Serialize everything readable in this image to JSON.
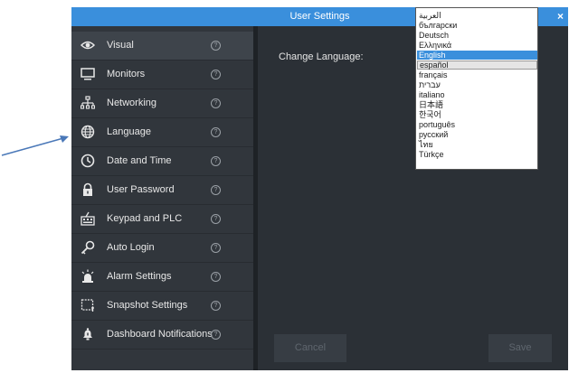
{
  "window": {
    "title": "User Settings",
    "close_glyph": "×"
  },
  "sidebar": {
    "items": [
      {
        "label": "Visual",
        "icon": "eye-icon"
      },
      {
        "label": "Monitors",
        "icon": "monitor-icon"
      },
      {
        "label": "Networking",
        "icon": "network-icon"
      },
      {
        "label": "Language",
        "icon": "globe-icon"
      },
      {
        "label": "Date and Time",
        "icon": "clock-icon"
      },
      {
        "label": "User Password",
        "icon": "lock-icon"
      },
      {
        "label": "Keypad and PLC",
        "icon": "keypad-icon"
      },
      {
        "label": "Auto Login",
        "icon": "key-icon"
      },
      {
        "label": "Alarm Settings",
        "icon": "alarm-icon"
      },
      {
        "label": "Snapshot Settings",
        "icon": "snapshot-icon"
      },
      {
        "label": "Dashboard Notifications",
        "icon": "bell-icon"
      }
    ],
    "help_glyph": "?"
  },
  "content": {
    "change_language_label": "Change Language:",
    "cancel_label": "Cancel",
    "save_label": "Save"
  },
  "language_dropdown": {
    "options": [
      "العربية",
      "български",
      "Deutsch",
      "Ελληνικά",
      "English",
      "español",
      "français",
      "עברית",
      "italiano",
      "日本語",
      "한국어",
      "português",
      "русский",
      "ไทย",
      "Türkçe"
    ],
    "selected": "English",
    "hovered": "español"
  },
  "colors": {
    "titlebar": "#3a8fdc",
    "sidebar_bg": "#31363c",
    "content_bg": "#2b3036",
    "arrow": "#4a78b8"
  }
}
